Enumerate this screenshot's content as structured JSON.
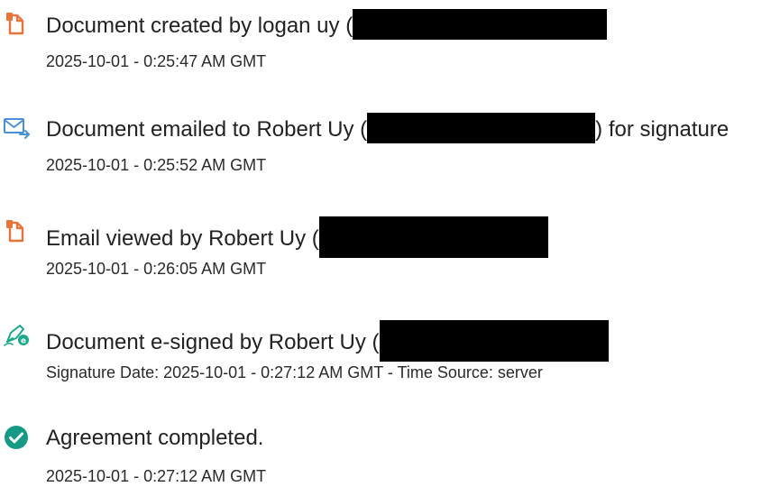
{
  "events": [
    {
      "icon": "document-icon",
      "title_text": "Document created by logan uy (",
      "title_suffix": "",
      "time": "2025-10-01 - 0:25:47 AM GMT"
    },
    {
      "icon": "email-send-icon",
      "title_text": "Document emailed to Robert Uy (",
      "title_suffix": ") for signature",
      "time": "2025-10-01 - 0:25:52 AM GMT"
    },
    {
      "icon": "document-icon",
      "title_text": "Email viewed by Robert Uy (",
      "title_suffix": "",
      "time": "2025-10-01 - 0:26:05 AM GMT"
    },
    {
      "icon": "esign-pen-icon",
      "title_text": "Document e-signed by Robert Uy (",
      "title_suffix": "",
      "time": "Signature Date: 2025-10-01 - 0:27:12 AM GMT - Time Source: server"
    },
    {
      "icon": "check-circle-icon",
      "title_text": "Agreement completed.",
      "title_suffix": "",
      "time": "2025-10-01 - 0:27:12 AM GMT"
    }
  ],
  "colors": {
    "document_icon": "#e8743b",
    "email_icon": "#4a90d9",
    "esign_icon": "#1aa88a",
    "check_icon": "#159b85",
    "redaction": "#000000"
  }
}
